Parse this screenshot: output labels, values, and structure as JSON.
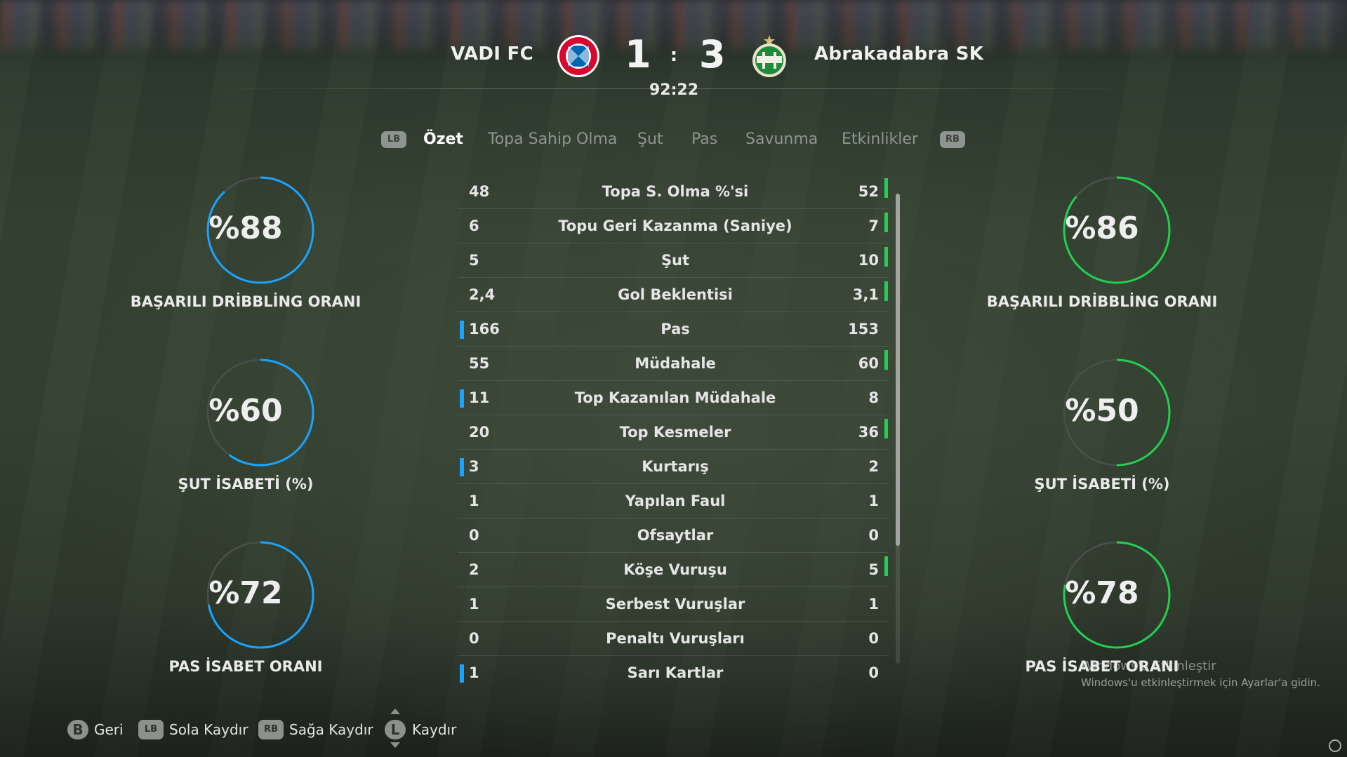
{
  "header": {
    "home_team": "VADI FC",
    "away_team": "Abrakadabra SK",
    "home_score": "1",
    "separator": ":",
    "away_score": "3",
    "clock": "92:22",
    "home_crest_icon": "fc-bayern-crest-icon",
    "away_crest_icon": "ferencvaros-crest-icon"
  },
  "tabs": {
    "left_bumper": "LB",
    "right_bumper": "RB",
    "items": [
      {
        "label": "Özet",
        "active": true
      },
      {
        "label": "Topa Sahip Olma",
        "active": false
      },
      {
        "label": "Şut",
        "active": false
      },
      {
        "label": "Pas",
        "active": false
      },
      {
        "label": "Savunma",
        "active": false
      },
      {
        "label": "Etkinlikler",
        "active": false
      }
    ]
  },
  "stats": [
    {
      "home": "48",
      "label": "Topa S. Olma %'si",
      "away": "52",
      "leader": "away"
    },
    {
      "home": "6",
      "label": "Topu Geri Kazanma (Saniye)",
      "away": "7",
      "leader": "away"
    },
    {
      "home": "5",
      "label": "Şut",
      "away": "10",
      "leader": "away"
    },
    {
      "home": "2,4",
      "label": "Gol Beklentisi",
      "away": "3,1",
      "leader": "away"
    },
    {
      "home": "166",
      "label": "Pas",
      "away": "153",
      "leader": "home"
    },
    {
      "home": "55",
      "label": "Müdahale",
      "away": "60",
      "leader": "away"
    },
    {
      "home": "11",
      "label": "Top Kazanılan Müdahale",
      "away": "8",
      "leader": "home"
    },
    {
      "home": "20",
      "label": "Top Kesmeler",
      "away": "36",
      "leader": "away"
    },
    {
      "home": "3",
      "label": "Kurtarış",
      "away": "2",
      "leader": "home"
    },
    {
      "home": "1",
      "label": "Yapılan Faul",
      "away": "1",
      "leader": "none"
    },
    {
      "home": "0",
      "label": "Ofsaytlar",
      "away": "0",
      "leader": "none"
    },
    {
      "home": "2",
      "label": "Köşe Vuruşu",
      "away": "5",
      "leader": "away"
    },
    {
      "home": "1",
      "label": "Serbest Vuruşlar",
      "away": "1",
      "leader": "none"
    },
    {
      "home": "0",
      "label": "Penaltı Vuruşları",
      "away": "0",
      "leader": "none"
    },
    {
      "home": "1",
      "label": "Sarı Kartlar",
      "away": "0",
      "leader": "home"
    }
  ],
  "home_rings": [
    {
      "value_text": "%88",
      "percent": 88,
      "label": "BAŞARILI DRİBBLİNG ORANI"
    },
    {
      "value_text": "%60",
      "percent": 60,
      "label": "ŞUT İSABETİ (%)"
    },
    {
      "value_text": "%72",
      "percent": 72,
      "label": "PAS İSABET ORANI"
    }
  ],
  "away_rings": [
    {
      "value_text": "%86",
      "percent": 86,
      "label": "BAŞARILI DRİBBLİNG ORANI"
    },
    {
      "value_text": "%50",
      "percent": 50,
      "label": "ŞUT İSABETİ (%)"
    },
    {
      "value_text": "%78",
      "percent": 78,
      "label": "PAS İSABET ORANI"
    }
  ],
  "colors": {
    "home_accent": "#1aa3ff",
    "away_accent": "#22d051",
    "ring_track": "#4a4f4b"
  },
  "footer": {
    "back_key": "B",
    "back_label": "Geri",
    "left_key": "LB",
    "left_label": "Sola Kaydır",
    "right_key": "RB",
    "right_label": "Sağa Kaydır",
    "scroll_key": "L",
    "scroll_label": "Kaydır"
  },
  "watermark": {
    "title": "Windows'u Etkinleştir",
    "subtitle": "Windows'u etkinleştirmek için Ayarlar'a gidin."
  }
}
